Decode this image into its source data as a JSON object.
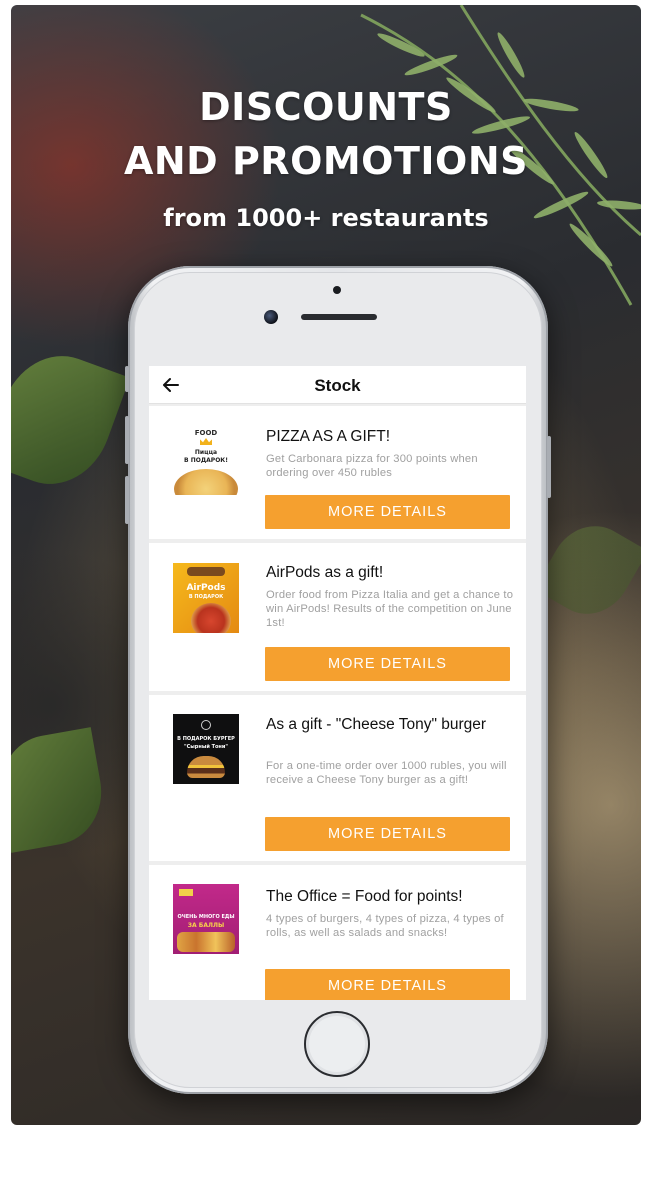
{
  "banner": {
    "line1": "DISCOUNTS",
    "line2": "AND PROMOTIONS",
    "subtitle": "from 1000+ restaurants"
  },
  "app": {
    "back_icon": "arrow-left-icon",
    "title": "Stock"
  },
  "promotions": [
    {
      "title": "PIZZA AS A GIFT!",
      "description": "Get Carbonara pizza for 300 points when ordering over 450 rubles",
      "button": "MORE DETAILS",
      "thumb": {
        "logo": "FOOD",
        "line1": "Пицца",
        "line2": "В ПОДАРОК!"
      }
    },
    {
      "title": "AirPods as a gift!",
      "description": "Order food from Pizza Italia and get a chance to win AirPods! Results of the competition on June 1st!",
      "button": "MORE DETAILS",
      "thumb": {
        "line1": "AirPods",
        "line2": "В ПОДАРОК"
      }
    },
    {
      "title": "As a gift - \"Cheese Tony\" burger",
      "description": "For a one-time order over 1000 rubles, you will receive a Cheese Tony burger as a gift!",
      "button": "MORE DETAILS",
      "thumb": {
        "line1": "В ПОДАРОК БУРГЕР",
        "line2": "\"Сырный Тони\""
      }
    },
    {
      "title": "The Office = Food for points!",
      "description": "4 types of burgers, 4 types of pizza, 4 types of rolls, as well as salads and snacks!",
      "button": "MORE DETAILS",
      "thumb": {
        "line1": "ОЧЕНЬ МНОГО ЕДЫ",
        "line2": "ЗА БАЛЛЫ"
      }
    }
  ],
  "colors": {
    "accent": "#f5a02f",
    "title_text": "#111111",
    "description_text": "#a0a0a0"
  }
}
